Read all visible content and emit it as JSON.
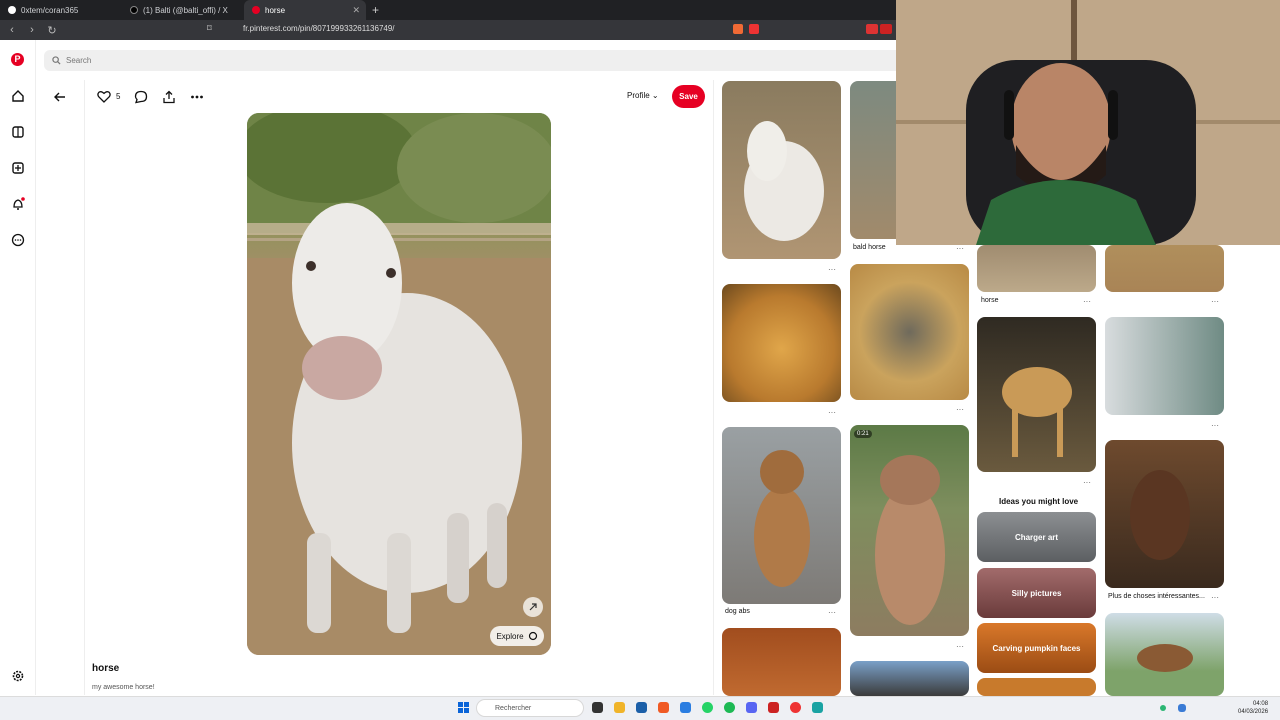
{
  "browser": {
    "tabs": [
      {
        "label": "0xtem/coran365"
      },
      {
        "label": "(1) Balti (@balti_offi) / X"
      },
      {
        "label": "horse"
      }
    ],
    "url": "fr.pinterest.com/pin/807199933261136749/"
  },
  "search": {
    "placeholder": "Search"
  },
  "pin": {
    "like_count": "5",
    "profile_label": "Profile",
    "save_label": "Save",
    "explore_label": "Explore",
    "title": "horse",
    "description": "my awesome horse!"
  },
  "grid": {
    "captions": {
      "bald_horse": "bald horse",
      "horse": "horse",
      "dog_abs": "dog abs",
      "plus": "Plus de choses intéressantes...",
      "video_time": "0:21"
    },
    "ideas_heading": "Ideas you might love",
    "ideas": [
      "Charger art",
      "Silly pictures",
      "Carving pumpkin faces"
    ]
  },
  "taskbar": {
    "search_placeholder": "Rechercher",
    "time": "04:08",
    "date": "04/03/2026"
  },
  "colors": {
    "pinterest_red": "#e60023",
    "chrome_dark": "#202124"
  }
}
